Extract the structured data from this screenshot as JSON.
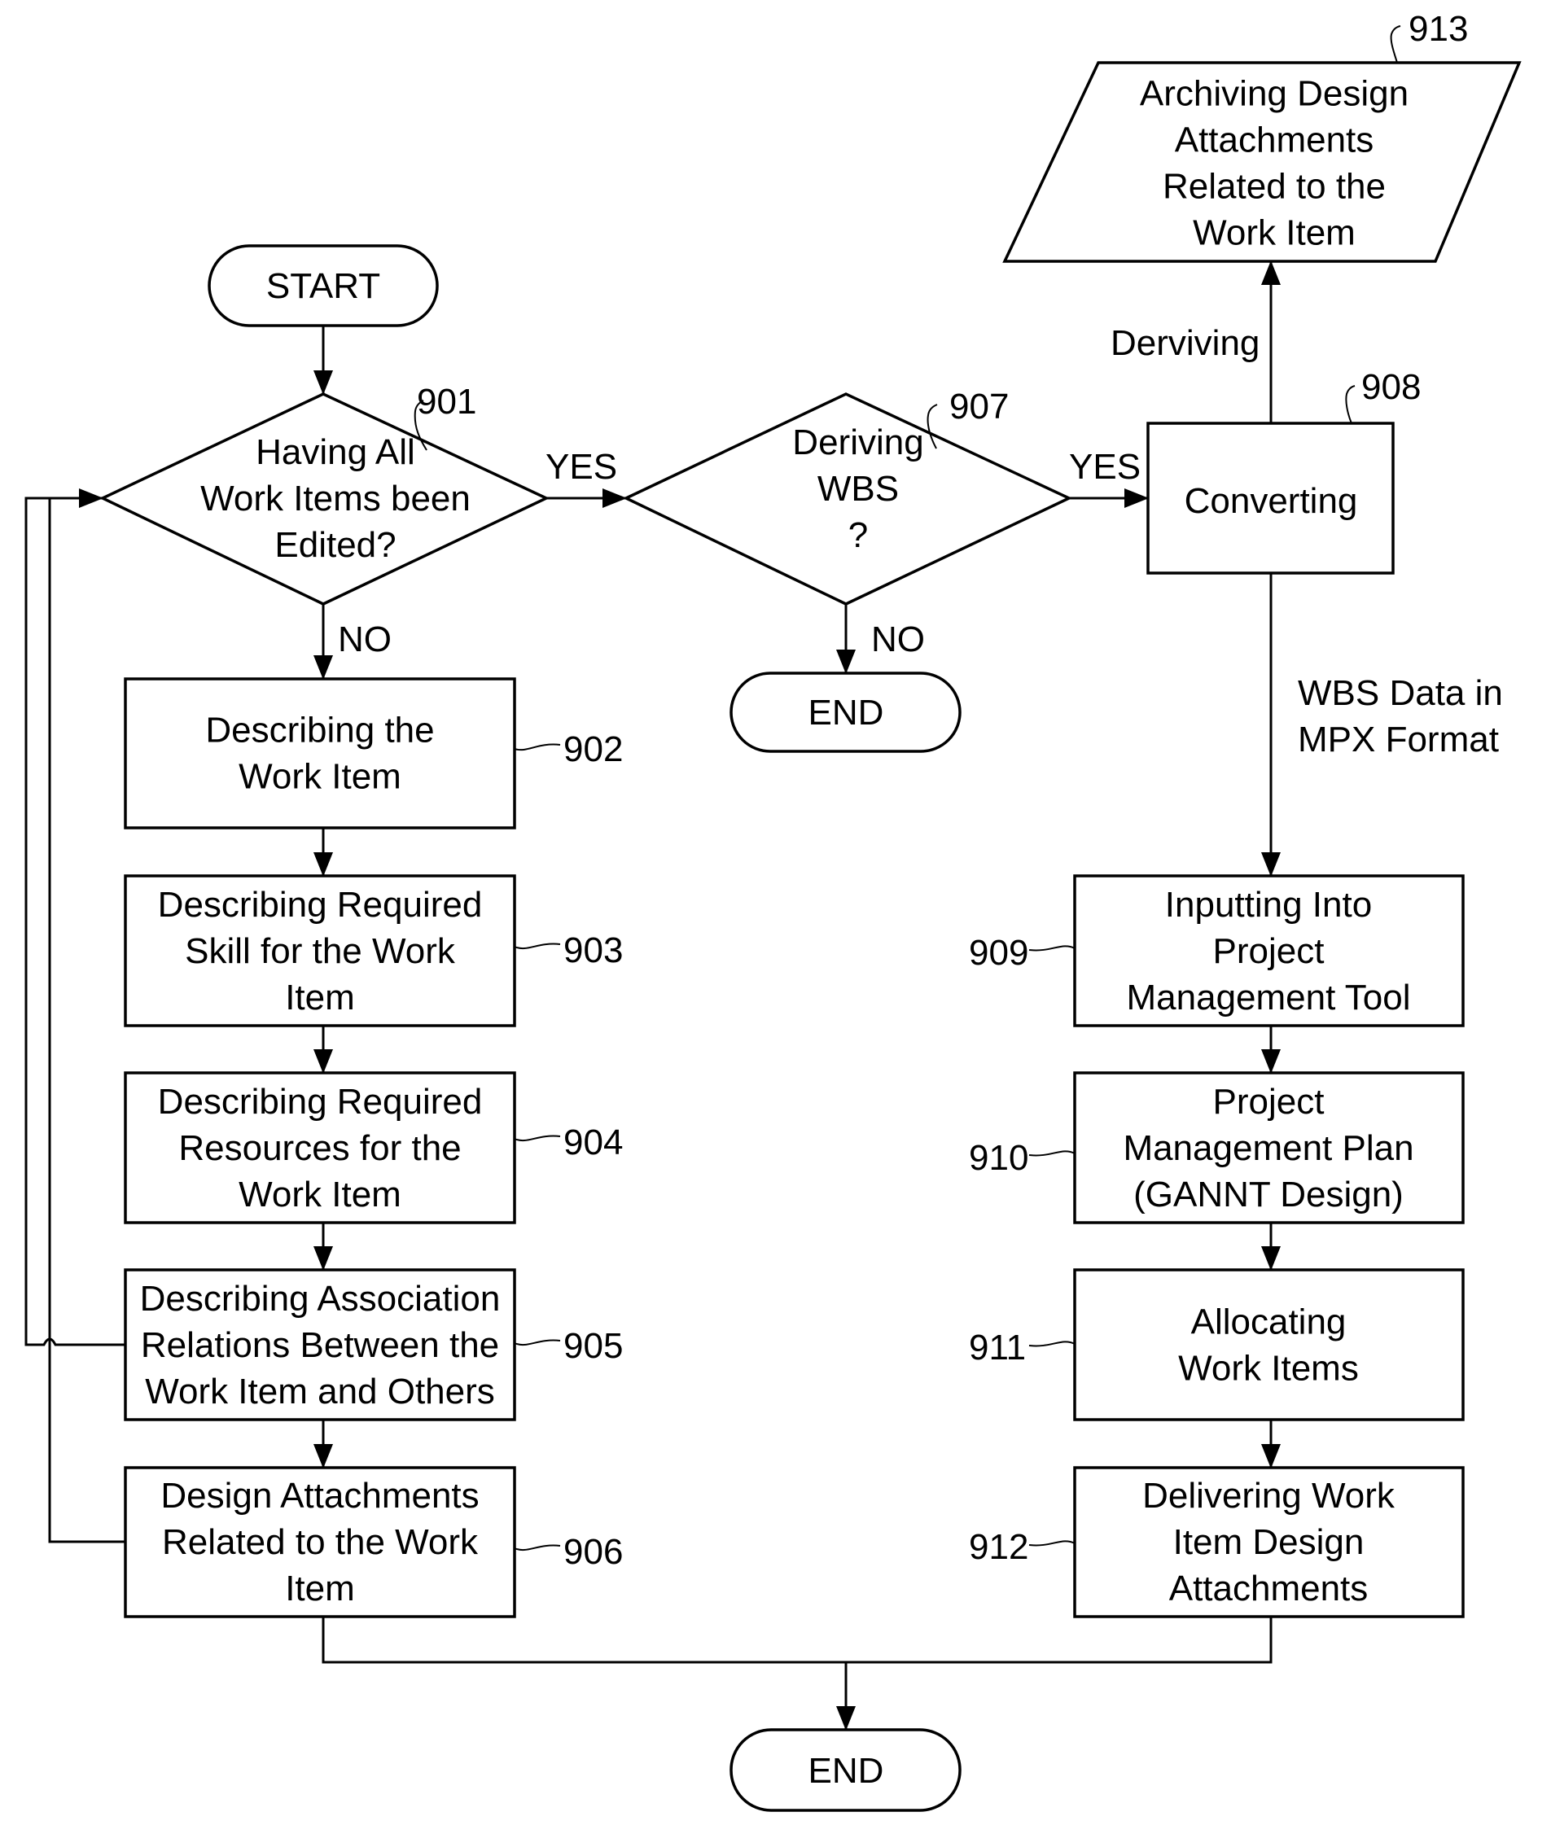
{
  "diagram": {
    "type": "flowchart",
    "nodes": [
      {
        "id": "start",
        "shape": "terminal",
        "lines": [
          "START"
        ]
      },
      {
        "id": "901",
        "shape": "decision",
        "ref": "901",
        "lines": [
          "Having All",
          "Work Items been",
          "Edited?"
        ]
      },
      {
        "id": "902",
        "shape": "process",
        "ref": "902",
        "lines": [
          "Describing the",
          "Work Item"
        ]
      },
      {
        "id": "903",
        "shape": "process",
        "ref": "903",
        "lines": [
          "Describing Required",
          "Skill for the Work",
          "Item"
        ]
      },
      {
        "id": "904",
        "shape": "process",
        "ref": "904",
        "lines": [
          "Describing Required",
          "Resources for the",
          "Work Item"
        ]
      },
      {
        "id": "905",
        "shape": "process",
        "ref": "905",
        "lines": [
          "Describing Association",
          "Relations Between the",
          "Work Item and Others"
        ]
      },
      {
        "id": "906",
        "shape": "process",
        "ref": "906",
        "lines": [
          "Design Attachments",
          "Related to the Work",
          "Item"
        ]
      },
      {
        "id": "907",
        "shape": "decision",
        "ref": "907",
        "lines": [
          "Deriving",
          "WBS",
          "?"
        ]
      },
      {
        "id": "end1",
        "shape": "terminal",
        "lines": [
          "END"
        ]
      },
      {
        "id": "908",
        "shape": "process",
        "ref": "908",
        "lines": [
          "Converting"
        ]
      },
      {
        "id": "913",
        "shape": "data",
        "ref": "913",
        "lines": [
          "Archiving Design",
          "Attachments",
          "Related to the",
          "Work Item"
        ]
      },
      {
        "id": "909",
        "shape": "process",
        "ref": "909",
        "lines": [
          "Inputting Into",
          "Project",
          "Management Tool"
        ]
      },
      {
        "id": "910",
        "shape": "process",
        "ref": "910",
        "lines": [
          "Project",
          "Management Plan",
          "(GANNT Design)"
        ]
      },
      {
        "id": "911",
        "shape": "process",
        "ref": "911",
        "lines": [
          "Allocating",
          "Work Items"
        ]
      },
      {
        "id": "912",
        "shape": "process",
        "ref": "912",
        "lines": [
          "Delivering Work",
          "Item Design",
          "Attachments"
        ]
      },
      {
        "id": "end2",
        "shape": "terminal",
        "lines": [
          "END"
        ]
      }
    ],
    "edges": [
      {
        "from": "start",
        "to": "901",
        "label": ""
      },
      {
        "from": "901",
        "to": "907",
        "label": "YES"
      },
      {
        "from": "901",
        "to": "902",
        "label": "NO"
      },
      {
        "from": "902",
        "to": "903",
        "label": ""
      },
      {
        "from": "903",
        "to": "904",
        "label": ""
      },
      {
        "from": "904",
        "to": "905",
        "label": ""
      },
      {
        "from": "905",
        "to": "906",
        "label": ""
      },
      {
        "from": "905",
        "to": "901",
        "label": ""
      },
      {
        "from": "906",
        "to": "901",
        "label": ""
      },
      {
        "from": "907",
        "to": "908",
        "label": "YES"
      },
      {
        "from": "907",
        "to": "end1",
        "label": "NO"
      },
      {
        "from": "908",
        "to": "913",
        "label": "Derviving"
      },
      {
        "from": "908",
        "to": "909",
        "label": "WBS Data in MPX Format"
      },
      {
        "from": "909",
        "to": "910",
        "label": ""
      },
      {
        "from": "910",
        "to": "911",
        "label": ""
      },
      {
        "from": "911",
        "to": "912",
        "label": ""
      },
      {
        "from": "906",
        "to": "end2",
        "label": ""
      },
      {
        "from": "912",
        "to": "end2",
        "label": ""
      }
    ],
    "edge_labels": {
      "yes_901": "YES",
      "no_901": "NO",
      "yes_907": "YES",
      "no_907": "NO",
      "deriving": "Derviving",
      "wbs_line1": "WBS Data in",
      "wbs_line2": "MPX Format"
    }
  }
}
